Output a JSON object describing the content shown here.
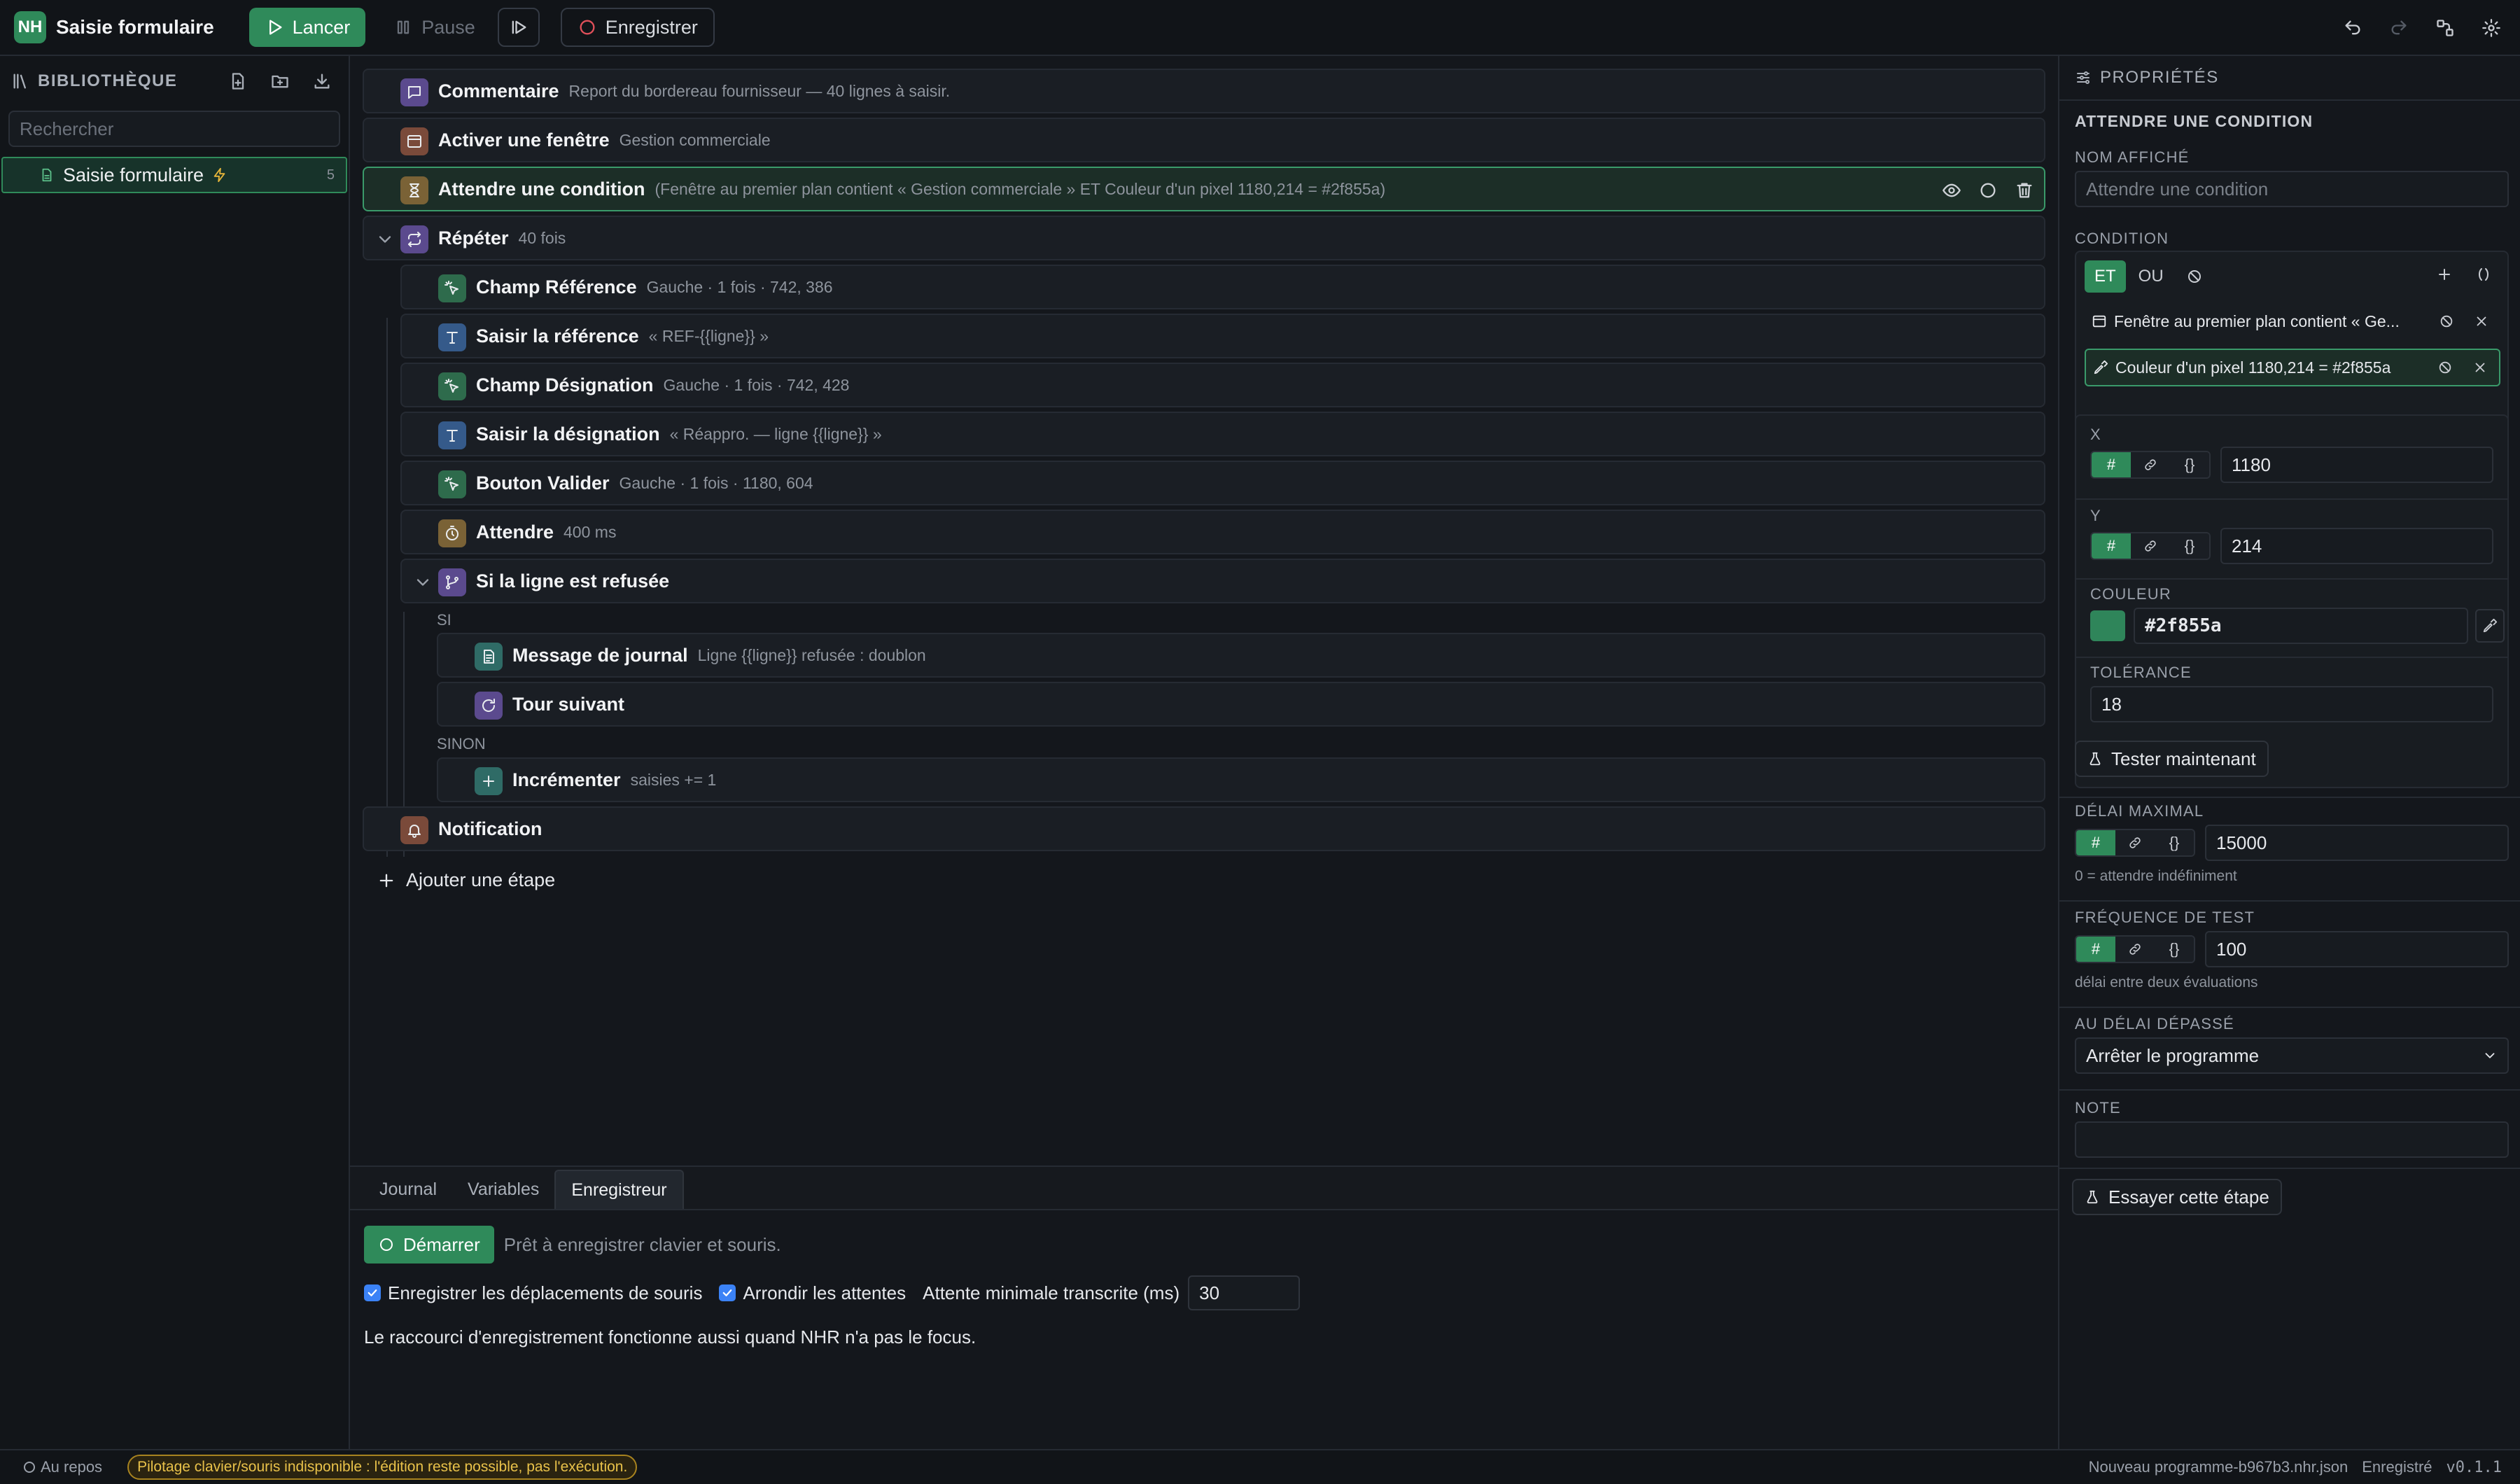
{
  "app": {
    "logo": "NH",
    "title": "Saisie formulaire"
  },
  "toolbar": {
    "run": "Lancer",
    "pause": "Pause",
    "record": "Enregistrer"
  },
  "sidebar": {
    "title": "BIBLIOTHÈQUE",
    "search_placeholder": "Rechercher",
    "items": [
      {
        "label": "Saisie formulaire",
        "count": "5"
      }
    ]
  },
  "steps": [
    {
      "title": "Commentaire",
      "detail": "Report du bordereau fournisseur — 40 lignes à saisir.",
      "icon": "comment-icon",
      "color": "#5b4a8e"
    },
    {
      "title": "Activer une fenêtre",
      "detail": "Gestion commerciale",
      "icon": "window-icon",
      "color": "#7a4a3a"
    },
    {
      "title": "Attendre une condition",
      "detail": "(Fenêtre au premier plan contient « Gestion commerciale » ET Couleur d'un pixel 1180,214 = #2f855a)",
      "icon": "hourglass-icon",
      "color": "#7a6236"
    },
    {
      "title": "Répéter",
      "detail": "40 fois",
      "icon": "repeat-icon",
      "color": "#5b4a8e"
    },
    {
      "title": "Champ Référence",
      "detail": "Gauche · 1 fois · 742, 386",
      "icon": "click-icon",
      "color": "#2e6b4c"
    },
    {
      "title": "Saisir la référence",
      "detail": "« REF-{{ligne}} »",
      "icon": "text-icon",
      "color": "#355a8a"
    },
    {
      "title": "Champ Désignation",
      "detail": "Gauche · 1 fois · 742, 428",
      "icon": "click-icon",
      "color": "#2e6b4c"
    },
    {
      "title": "Saisir la désignation",
      "detail": "« Réappro. — ligne {{ligne}} »",
      "icon": "text-icon",
      "color": "#355a8a"
    },
    {
      "title": "Bouton Valider",
      "detail": "Gauche · 1 fois · 1180, 604",
      "icon": "click-icon",
      "color": "#2e6b4c"
    },
    {
      "title": "Attendre",
      "detail": "400 ms",
      "icon": "timer-icon",
      "color": "#7a6236"
    },
    {
      "title": "Si la ligne est refusée",
      "detail": "",
      "icon": "branch-icon",
      "color": "#5b4a8e"
    },
    {
      "title": "Message de journal",
      "detail": "Ligne {{ligne}} refusée : doublon",
      "icon": "log-icon",
      "color": "#2f6b66"
    },
    {
      "title": "Tour suivant",
      "detail": "",
      "icon": "next-icon",
      "color": "#5b4a8e"
    },
    {
      "title": "Incrémenter",
      "detail": "saisies += 1",
      "icon": "plus-icon",
      "color": "#2f6b66"
    },
    {
      "title": "Notification",
      "detail": "",
      "icon": "bell-icon",
      "color": "#7a4a3a"
    }
  ],
  "branch_labels": {
    "if": "SI",
    "else": "SINON"
  },
  "add_step": "Ajouter une étape",
  "bottom": {
    "tabs": [
      "Journal",
      "Variables",
      "Enregistreur"
    ],
    "active_tab": "Enregistreur",
    "start": "Démarrer",
    "ready": "Prêt à enregistrer clavier et souris.",
    "opt_mouse": "Enregistrer les déplacements de souris",
    "opt_round": "Arrondir les attentes",
    "min_wait_label": "Attente minimale transcrite (ms)",
    "min_wait_value": "30",
    "note": "Le raccourci d'enregistrement fonctionne aussi quand NHR n'a pas le focus."
  },
  "props": {
    "title": "PROPRIÉTÉS",
    "step_type": "ATTENDRE UNE CONDITION",
    "display_name_label": "NOM AFFICHÉ",
    "display_name_placeholder": "Attendre une condition",
    "condition_label": "CONDITION",
    "and": "ET",
    "or": "OU",
    "conditions": [
      "Fenêtre au premier plan contient « Ge...",
      "Couleur d'un pixel 1180,214 = #2f855a"
    ],
    "x_label": "X",
    "x_value": "1180",
    "y_label": "Y",
    "y_value": "214",
    "color_label": "COULEUR",
    "color_value": "#2f855a",
    "tolerance_label": "TOLÉRANCE",
    "tolerance_value": "18",
    "test_now": "Tester maintenant",
    "timeout_label": "DÉLAI MAXIMAL",
    "timeout_value": "15000",
    "timeout_hint": "0 = attendre indéfiniment",
    "freq_label": "FRÉQUENCE DE TEST",
    "freq_value": "100",
    "freq_hint": "délai entre deux évaluations",
    "on_timeout_label": "AU DÉLAI DÉPASSÉ",
    "on_timeout_value": "Arrêter le programme",
    "note_label": "NOTE",
    "try_step": "Essayer cette étape"
  },
  "status": {
    "idle": "Au repos",
    "warning": "Pilotage clavier/souris indisponible : l'édition reste possible, pas l'exécution.",
    "file": "Nouveau programme-b967b3.nhr.json",
    "saved": "Enregistré",
    "version": "v0.1.1"
  }
}
